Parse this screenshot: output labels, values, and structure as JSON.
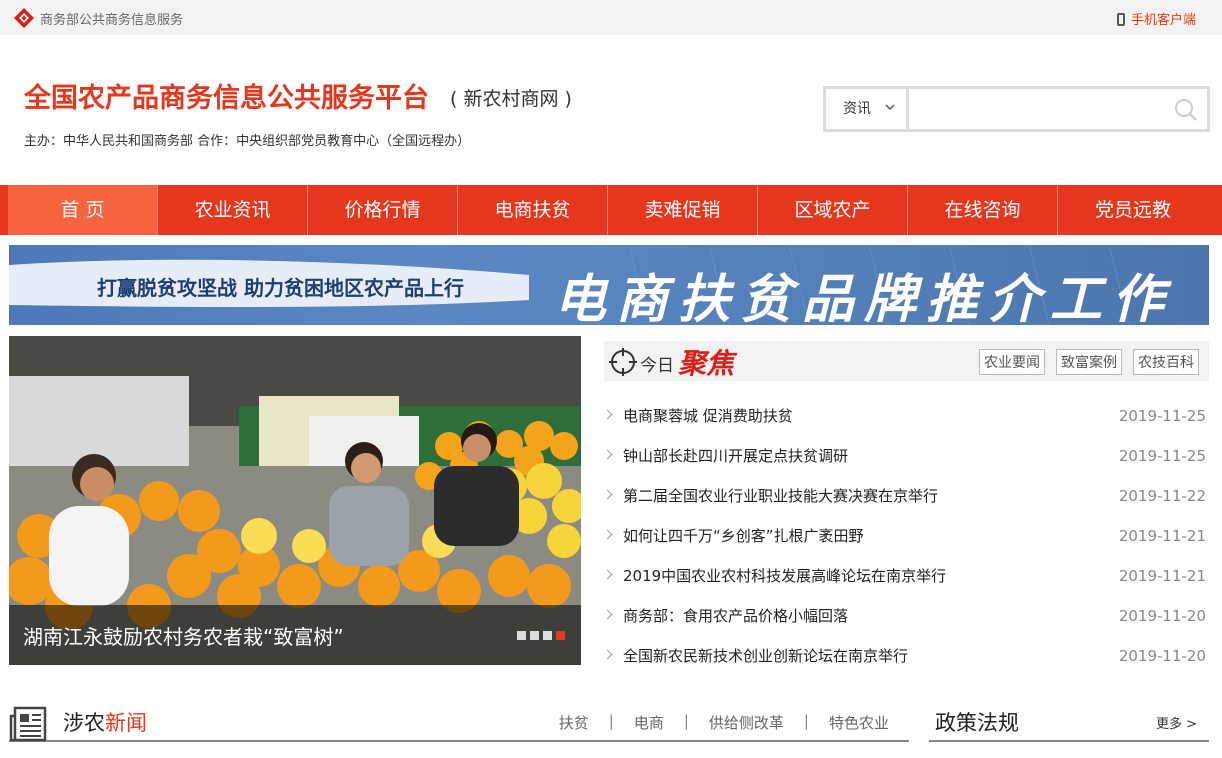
{
  "topbar": {
    "site_name": "商务部公共商务信息服务",
    "mobile_label": "手机客户端"
  },
  "header": {
    "title": "全国农产品商务信息公共服务平台",
    "subtitle": "( 新农村商网 )",
    "sponsor": "主办：中华人民共和国商务部  合作：中央组织部党员教育中心（全国远程办）"
  },
  "search": {
    "type_label": "资讯",
    "placeholder": ""
  },
  "nav": {
    "items": [
      "首 页",
      "农业资讯",
      "价格行情",
      "电商扶贫",
      "卖难促销",
      "区域农产",
      "在线咨询",
      "党员远教"
    ],
    "active_index": 0
  },
  "banner": {
    "left_text": "打赢脱贫攻坚战  助力贫困地区农产品上行",
    "right_text": "电商扶贫品牌推介工作"
  },
  "slider": {
    "caption": "湖南江永鼓励农村务农者栽“致富树”",
    "dot_count": 4,
    "active_dot": 3
  },
  "focus": {
    "today": "今日",
    "focus": "聚焦",
    "tabs": [
      "农业要闻",
      "致富案例",
      "农技百科"
    ],
    "news": [
      {
        "title": "电商聚蓉城 促消费助扶贫",
        "date": "2019-11-25"
      },
      {
        "title": "钟山部长赴四川开展定点扶贫调研",
        "date": "2019-11-25"
      },
      {
        "title": "第二届全国农业行业职业技能大赛决赛在京举行",
        "date": "2019-11-22"
      },
      {
        "title": "如何让四千万“乡创客”扎根广袤田野",
        "date": "2019-11-21"
      },
      {
        "title": "2019中国农业农村科技发展高峰论坛在南京举行",
        "date": "2019-11-21"
      },
      {
        "title": "商务部：食用农产品价格小幅回落",
        "date": "2019-11-20"
      },
      {
        "title": "全国新农民新技术创业创新论坛在南京举行",
        "date": "2019-11-20"
      }
    ]
  },
  "sections": {
    "news_label_a": "涉农",
    "news_label_b": "新闻",
    "news_links": [
      "扶贫",
      "电商",
      "供给侧改革",
      "特色农业"
    ],
    "policy_label": "政策法规",
    "more_label": "更多 >"
  },
  "colors": {
    "brand_red": "#e4371e",
    "nav_active": "#f6633f",
    "banner_blue": "#4b79b9"
  }
}
